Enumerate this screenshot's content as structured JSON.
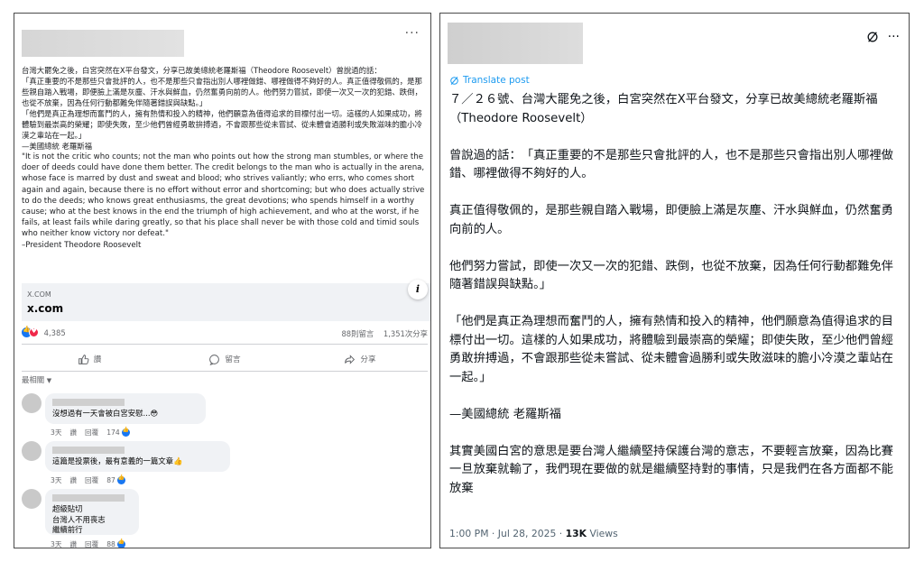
{
  "left_post": {
    "more_label": "···",
    "intro": "台灣大罷免之後，白宮突然在X平台發文，分享已故美總統老羅斯福（Theodore Roosevelt）曾說過的話：",
    "quote_zh_1": "「真正重要的不是那些只會批評的人，也不是那些只會指出別人哪裡做錯、哪裡做得不夠好的人。真正值得敬佩的，是那些親自踏入戰場，即便臉上滿是灰塵、汗水與鮮血，仍然奮勇向前的人。他們努力嘗試，即使一次又一次的犯錯、跌倒，也從不放棄，因為任何行動都難免伴隨著錯誤與缺點。」",
    "quote_zh_2": "「他們是真正為理想而奮鬥的人，擁有熱情和投入的精神，他們願意為值得追求的目標付出一切。這樣的人如果成功，將體驗到最崇高的榮耀；即使失敗，至少他們曾經勇敢拚搏過，不會跟那些從未嘗試、從未體會過勝利或失敗滋味的膽小冷漠之輩站在一起。」",
    "attribution_zh": "—美國總統 老羅斯福",
    "quote_en": "\"It is not the critic who counts; not the man who points out how the strong man stumbles, or where the doer of deeds could have done them better. The credit belongs to the man who is actually in the arena, whose face is marred by dust and sweat and blood; who strives valiantly; who errs, who comes short again and again, because there is no effort without error and shortcoming; but who does actually strive to do the deeds; who knows great enthusiasms, the great devotions; who spends himself in a worthy cause; who at the best knows in the end the triumph of high achievement, and who at the worst, if he fails, at least fails while daring greatly, so that his place shall never be with those cold and timid souls who neither know victory nor defeat.\"",
    "attribution_en": "–President Theodore Roosevelt",
    "link_domain_small": "X.COM",
    "link_domain": "x.com",
    "info_icon": "i",
    "reactions_count": "4,385",
    "comments_count": "88則留言",
    "shares_count": "1,351次分享",
    "actions": {
      "like": "讚",
      "comment": "留言",
      "share": "分享"
    },
    "sort_label": "最相關",
    "comments": [
      {
        "text": "沒想過有一天會被白宮安慰...😳",
        "time": "3天",
        "like": "讚",
        "reply": "回覆",
        "likes": "174"
      },
      {
        "text": "這篇是投票後，最有意義的一篇文章👍",
        "time": "3天",
        "like": "讚",
        "reply": "回覆",
        "likes": "87"
      },
      {
        "text_lines": [
          "超級貼切",
          "台灣人不用喪志",
          "繼續前行"
        ],
        "time": "3天",
        "like": "讚",
        "reply": "回覆",
        "likes": "88"
      }
    ]
  },
  "right_post": {
    "more_label": "···",
    "translate_label": "Translate post",
    "p1": "７／２６號、台灣大罷免之後，白宮突然在X平台發文，分享已故美總統老羅斯福（Theodore Roosevelt）",
    "p2": "曾說過的話：　「真正重要的不是那些只會批評的人，也不是那些只會指出別人哪裡做錯、哪裡做得不夠好的人。",
    "p3": "真正值得敬佩的，是那些親自踏入戰場，即便臉上滿是灰塵、汗水與鮮血，仍然奮勇向前的人。",
    "p4": "他們努力嘗試，即使一次又一次的犯錯、跌倒，也從不放棄，因為任何行動都難免伴隨著錯誤與缺點。」",
    "p5": "「他們是真正為理想而奮鬥的人，擁有熱情和投入的精神，他們願意為值得追求的目標付出一切。這樣的人如果成功，將體驗到最崇高的榮耀；即使失敗，至少他們曾經勇敢拚搏過，不會跟那些從未嘗試、從未體會過勝利或失敗滋味的膽小冷漠之輩站在一起。」",
    "p6": "—美國總統 老羅斯福",
    "p7": "其實美國白宮的意思是要台灣人繼續堅持保護台灣的意志，不要輕言放棄，因為比賽一旦放棄就輸了，我們現在要做的就是繼續堅持對的事情，只是我們在各方面都不能放棄",
    "timestamp": "1:00 PM · Jul 28, 2025 · ",
    "views_count": "13K",
    "views_label": " Views"
  },
  "colors": {
    "facebook_blue": "#1877f2",
    "love_red": "#f0284a",
    "x_link_blue": "#1d9bf0",
    "panel_border": "#4a4a4a"
  },
  "icons": [
    "more-options-icon",
    "info-icon",
    "like-reaction-icon",
    "love-reaction-icon",
    "thumbs-up-icon",
    "comment-icon",
    "share-icon",
    "grok-icon",
    "translate-icon"
  ]
}
